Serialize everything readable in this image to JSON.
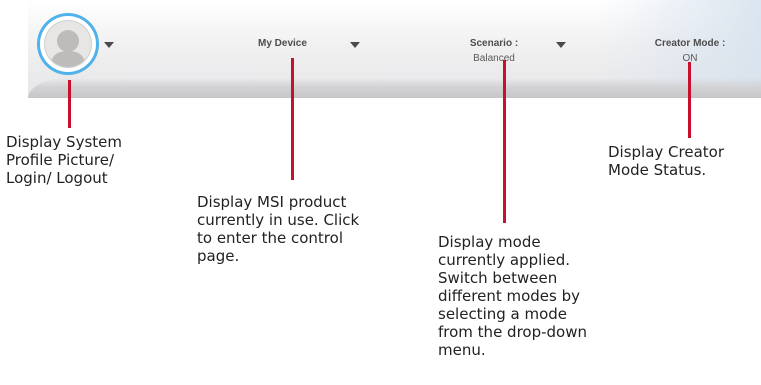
{
  "toolbar": {
    "device_label": "My Device",
    "scenario_label": "Scenario :",
    "scenario_value": "Balanced",
    "creator_label": "Creator Mode :",
    "creator_value": "ON"
  },
  "icons": {
    "avatar": "user-silhouette-icon",
    "dropdown": "caret-down-icon"
  },
  "colors": {
    "avatar_ring": "#4fb2ea",
    "callout_line": "#c8102e"
  },
  "annotations": {
    "profile": [
      "Display System",
      "Profile Picture/",
      "Login/ Logout"
    ],
    "device": [
      "Display MSI product",
      "currently in use. Click",
      "to enter the control",
      "page."
    ],
    "scenario": [
      "Display mode",
      "currently applied.",
      "Switch between",
      "different modes by",
      "selecting a mode",
      "from the drop-down",
      "menu."
    ],
    "creator": [
      "Display Creator",
      "Mode Status."
    ]
  }
}
